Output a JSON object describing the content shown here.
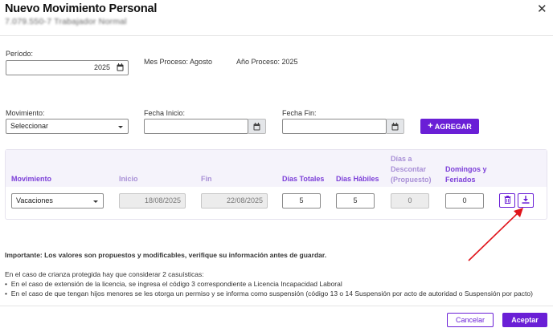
{
  "modal": {
    "title": "Nuevo Movimiento Personal",
    "subtitle": "7.079.550-7 Trabajador Normal"
  },
  "periodo": {
    "label": "Período:",
    "value": "2025"
  },
  "proceso": {
    "mes": "Mes Proceso: Agosto",
    "anio": "Año Proceso: 2025"
  },
  "form": {
    "movimiento_label": "Movimiento:",
    "movimiento_value": "Seleccionar",
    "fecha_inicio_label": "Fecha Inicio:",
    "fecha_inicio_value": "",
    "fecha_fin_label": "Fecha Fin:",
    "fecha_fin_value": "",
    "agregar_label": "AGREGAR"
  },
  "table": {
    "headers": {
      "movimiento": "Movimiento",
      "inicio": "Inicio",
      "fin": "Fin",
      "dias_totales": "Días Totales",
      "dias_habiles": "Días Hábiles",
      "dias_descontar_1": "Días a",
      "dias_descontar_2": "Descontar",
      "dias_descontar_3": "(Propuesto)",
      "domingos_1": "Domingos y",
      "domingos_2": "Feriados"
    },
    "row": {
      "movimiento": "Vacaciones",
      "inicio": "18/08/2025",
      "fin": "22/08/2025",
      "dias_totales": "5",
      "dias_habiles": "5",
      "dias_descontar": "0",
      "domingos": "0"
    }
  },
  "notes": {
    "importante": "Importante: Los valores son propuestos y modificables, verifique su información antes de guardar.",
    "crianza": "En el caso de crianza protegida hay que considerar 2 casuísticas:",
    "bullet1": "En el caso de extensión de la licencia, se ingresa el código 3 correspondiente a Licencia Incapacidad Laboral",
    "bullet2": "En el caso de que tengan hijos menores se les otorga un permiso y se informa como suspensión (código 13 o 14 Suspensión por acto de autoridad o Suspensión por pacto)"
  },
  "footer": {
    "cancel_label": "Cancelar",
    "accept_label": "Aceptar"
  },
  "colors": {
    "accent": "#6a1fd6",
    "header_text": "#7c3fd8",
    "annotation_arrow": "#e0141b"
  },
  "icons": {
    "calendar": "calendar-icon",
    "trash": "trash-icon",
    "download": "download-icon",
    "close": "close-icon",
    "plus": "plus-icon"
  }
}
